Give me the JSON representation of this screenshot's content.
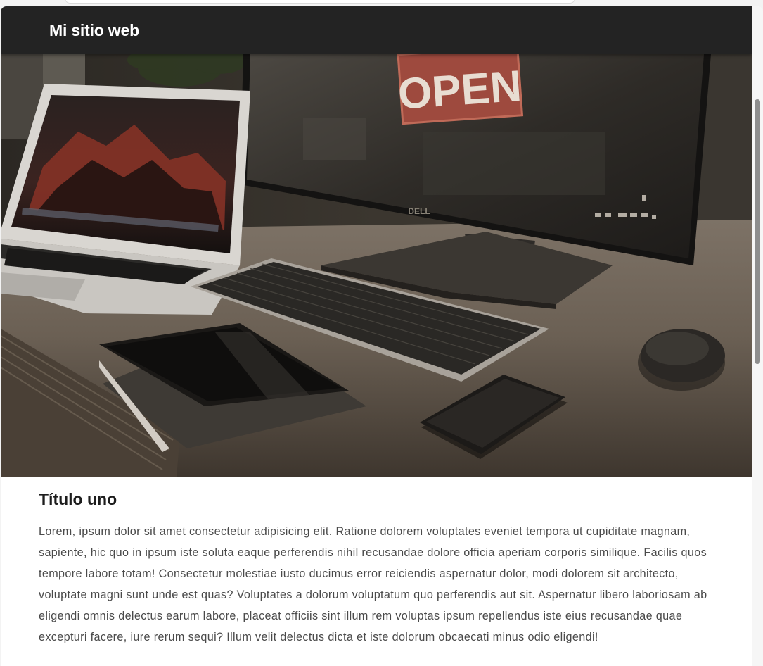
{
  "navbar": {
    "brand": "Mi sitio web"
  },
  "hero": {
    "image_description_icon": "desk-workspace-photo-icon",
    "sign_text": "OPEN",
    "monitor_brand": "DELL"
  },
  "article": {
    "title": "Título uno",
    "body": "Lorem, ipsum dolor sit amet consectetur adipisicing elit. Ratione dolorem voluptates eveniet tempora ut cupiditate magnam, sapiente, hic quo in ipsum iste soluta eaque perferendis nihil recusandae dolore officia aperiam corporis similique. Facilis quos tempore labore totam! Consectetur molestiae iusto ducimus error reiciendis aspernatur dolor, modi dolorem sit architecto, voluptate magni sunt unde est quas? Voluptates a dolorum voluptatum quo perferendis aut sit. Aspernatur libero laboriosam ab eligendi omnis delectus earum labore, placeat officiis sint illum rem voluptas ipsum repellendus iste eius recusandae quae excepturi facere, iure rerum sequi? Illum velit delectus dicta et iste dolorum obcaecati minus odio eligendi!"
  },
  "colors": {
    "navbar_bg": "#232323",
    "brand_text": "#ffffff",
    "title_text": "#1d1d1d",
    "body_text": "#4a4a4a"
  }
}
